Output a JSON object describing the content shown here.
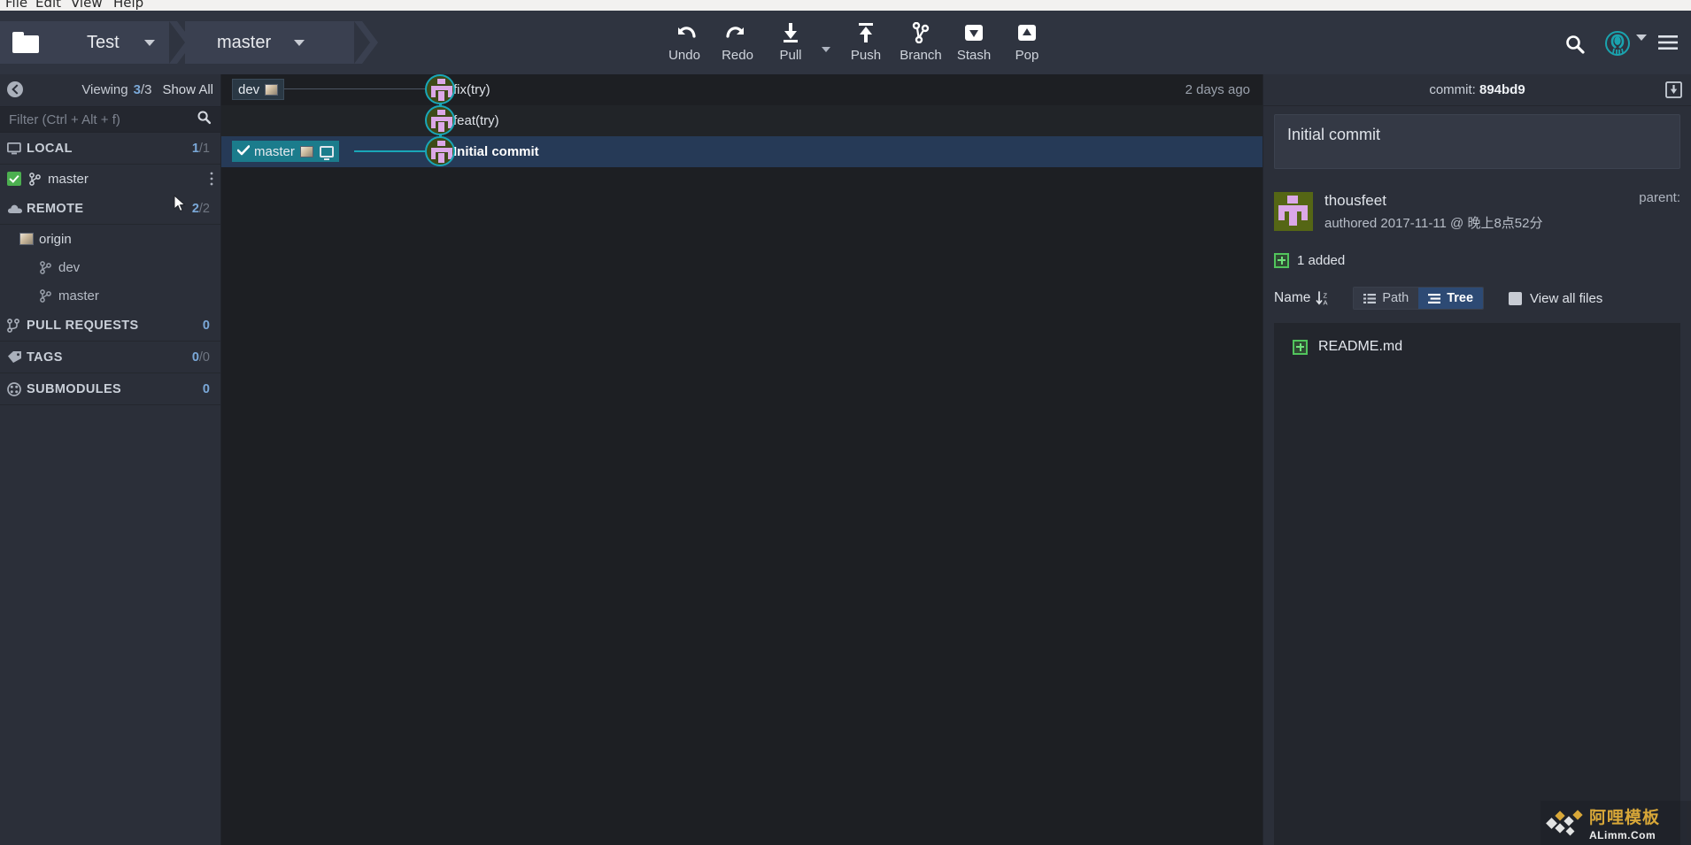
{
  "menubar": {
    "items": [
      "File",
      "Edit",
      "View",
      "Help"
    ]
  },
  "toolbar": {
    "repo_name": "Test",
    "branch_name": "master",
    "actions": [
      {
        "label": "Undo",
        "icon": "undo-icon"
      },
      {
        "label": "Redo",
        "icon": "redo-icon"
      },
      {
        "label": "Pull",
        "icon": "pull-icon"
      },
      {
        "label": "Push",
        "icon": "push-icon"
      },
      {
        "label": "Branch",
        "icon": "branch-icon"
      },
      {
        "label": "Stash",
        "icon": "stash-icon"
      },
      {
        "label": "Pop",
        "icon": "pop-icon"
      }
    ],
    "right_icons": [
      "search-icon",
      "gitkraken-logo-icon",
      "chevron-down-icon",
      "hamburger-menu-icon"
    ]
  },
  "sidebar": {
    "viewing_label": "Viewing",
    "viewing_current": "3",
    "viewing_total": "/3",
    "show_all": "Show All",
    "filter_placeholder": "Filter (Ctrl + Alt + f)",
    "filter_value": "",
    "sections": [
      {
        "name": "LOCAL",
        "count": "1",
        "count_dim": "/1",
        "icon": "monitor-icon"
      },
      {
        "name": "REMOTE",
        "count": "2",
        "count_dim": "/2",
        "icon": "cloud-icon"
      },
      {
        "name": "PULL REQUESTS",
        "count": "0",
        "count_dim": "",
        "icon": "pull-request-icon"
      },
      {
        "name": "TAGS",
        "count": "0",
        "count_dim": "/0",
        "icon": "tag-icon"
      },
      {
        "name": "SUBMODULES",
        "count": "0",
        "count_dim": "",
        "icon": "submodule-icon"
      }
    ],
    "local_branches": [
      {
        "label": "master",
        "checked": true
      }
    ],
    "remote_host": "origin",
    "remote_branches": [
      {
        "label": "dev"
      },
      {
        "label": "master"
      }
    ]
  },
  "graph": {
    "commits": [
      {
        "message": "fix(try)",
        "time": "2 days ago",
        "selected": false
      },
      {
        "message": "feat(try)",
        "time": "",
        "selected": false
      },
      {
        "message": "Initial commit",
        "time": "",
        "selected": true
      }
    ],
    "ref_labels": [
      {
        "name": "dev",
        "current": false,
        "row": 0
      },
      {
        "name": "master",
        "current": true,
        "row": 2
      }
    ]
  },
  "detail": {
    "commit_label": "commit:",
    "commit_sha": "894bd9",
    "download_icon": "download-box-icon",
    "message": "Initial commit",
    "author": "thousfeet",
    "authored_text": "authored 2017-11-11 @ 晚上8点52分",
    "parent_label": "parent:",
    "added_summary": "1 added",
    "name_column": "Name",
    "sort_icon": "sort-descending-az-icon",
    "view_path_label": "Path",
    "view_tree_label": "Tree",
    "view_all_files_label": "View all files",
    "files": [
      {
        "name": "README.md",
        "status": "added"
      }
    ]
  },
  "watermark": {
    "cn": "阿哩模板",
    "en": "ALimm.Com"
  },
  "colors": {
    "accent_teal": "#19a7b8",
    "selection_blue": "#263a57",
    "panel_bg": "#2b2f39",
    "graph_bg": "#1d1f23",
    "toolbar_bg": "#2f3440",
    "added_green": "#51c45c",
    "count_blue": "#7aa8d8"
  }
}
